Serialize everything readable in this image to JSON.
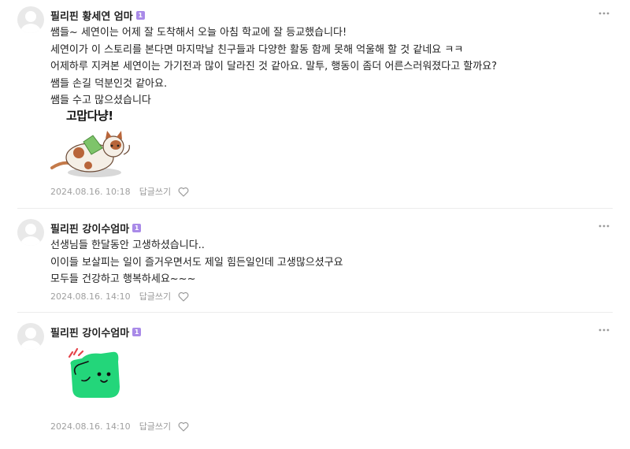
{
  "comments": [
    {
      "author": "필리핀 황세연 엄마",
      "badge": "1",
      "lines": [
        "쌤들~ 세연이는 어제 잘 도착해서 오늘 아침 학교에 잘 등교했습니다!",
        "세연이가 이 스토리를 본다면 마지막날 친구들과 다양한 활동 함께 못해 억울해 할 것 같네요 ㅋㅋ",
        "어제하루 지켜본 세연이는 가기전과 많이 달라진 것 같아요. 말투, 행동이 좀더 어른스러워졌다고 할까요?",
        "쌤들 손길 덕분인것 같아요.",
        "쌤들 수고 많으셨습니다"
      ],
      "sticker_text": "고맙다냥!",
      "date": "2024.08.16. 10:18",
      "reply_label": "답글쓰기"
    },
    {
      "author": "필리핀 강이수엄마",
      "badge": "1",
      "lines": [
        "선생님들 한달동안 고생하셨습니다..",
        "이이들 보살피는 일이 즐거우면서도 제일 힘든일인데 고생많으셨구요",
        "모두들 건강하고 행복하세요~~~"
      ],
      "date": "2024.08.16. 14:10",
      "reply_label": "답글쓰기"
    },
    {
      "author": "필리핀 강이수엄마",
      "badge": "1",
      "date": "2024.08.16. 14:10",
      "reply_label": "답글쓰기"
    }
  ],
  "icons": {
    "more": "more-options-icon",
    "like": "heart-icon",
    "avatar": "default-avatar"
  },
  "colors": {
    "badge": "#a98ae8",
    "meta_text": "#a0a0a0",
    "sticker_green": "#23d67a"
  }
}
